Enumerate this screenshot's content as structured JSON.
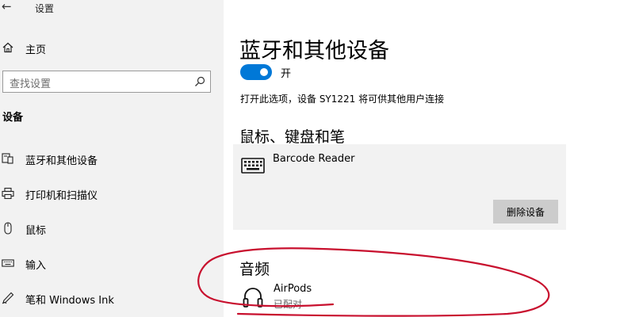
{
  "window": {
    "back_glyph": "←",
    "title": "设置"
  },
  "sidebar": {
    "home_label": "主页",
    "search_placeholder": "查找设置",
    "section_header": "设备",
    "items": [
      {
        "label": "蓝牙和其他设备",
        "icon": "bluetooth-devices-icon",
        "selected": true
      },
      {
        "label": "打印机和扫描仪",
        "icon": "printer-icon"
      },
      {
        "label": "鼠标",
        "icon": "mouse-icon"
      },
      {
        "label": "输入",
        "icon": "keyboard-icon"
      },
      {
        "label": "笔和 Windows Ink",
        "icon": "pen-icon"
      }
    ]
  },
  "main": {
    "title": "蓝牙和其他设备",
    "bluetooth_toggle": {
      "state_label": "开",
      "on": true
    },
    "discoverable_text": "打开此选项，设备 SY1221 将可供其他用户连接",
    "group_title": "鼠标、键盘和笔",
    "devices": [
      {
        "name": "Barcode Reader",
        "icon": "keyboard-icon",
        "action_label": "删除设备"
      }
    ],
    "audio_title": "音频",
    "audio_devices": [
      {
        "name": "AirPods",
        "status": "已配对",
        "icon": "headphones-icon"
      }
    ]
  },
  "colors": {
    "accent": "#0078d7",
    "sidebar_bg": "#f2f2f2",
    "annotation": "#c8102e"
  }
}
